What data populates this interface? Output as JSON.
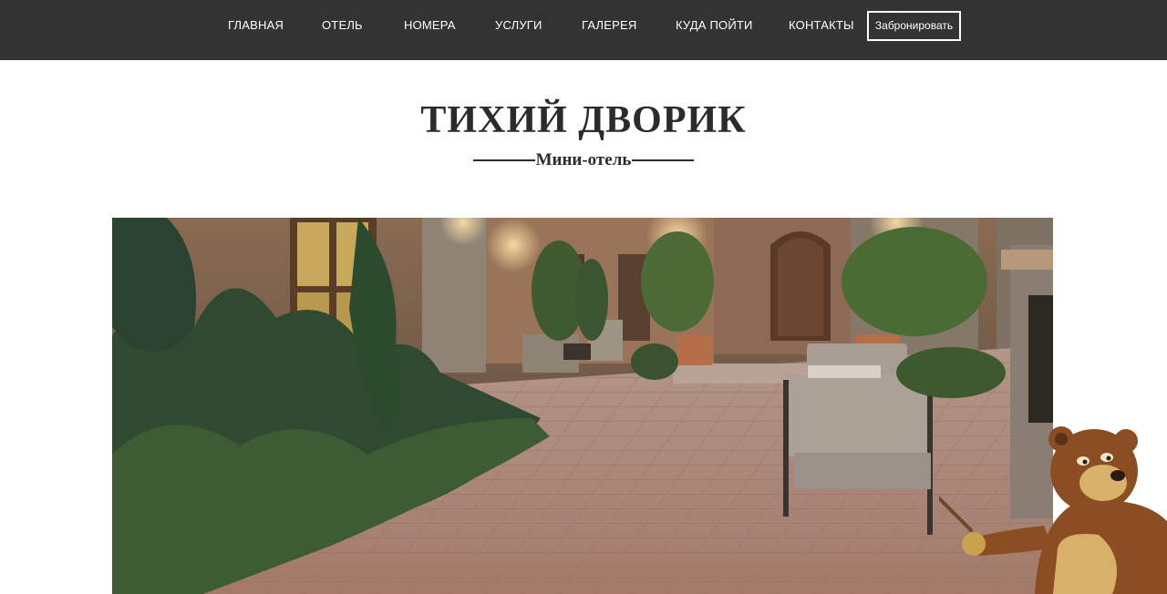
{
  "nav": {
    "items": [
      {
        "label": "ГЛАВНАЯ"
      },
      {
        "label": "ОТЕЛЬ"
      },
      {
        "label": "НОМЕРА"
      },
      {
        "label": "УСЛУГИ"
      },
      {
        "label": "ГАЛЕРЕЯ"
      },
      {
        "label": "КУДА ПОЙТИ"
      },
      {
        "label": "КОНТАКТЫ"
      }
    ],
    "book_button": "Забронировать"
  },
  "hero": {
    "title": "ТИХИЙ ДВОРИК",
    "subtitle": "Мини-отель"
  },
  "colors": {
    "nav_bg": "#333333",
    "nav_text": "#ffffff",
    "title": "#2b2b2b"
  }
}
